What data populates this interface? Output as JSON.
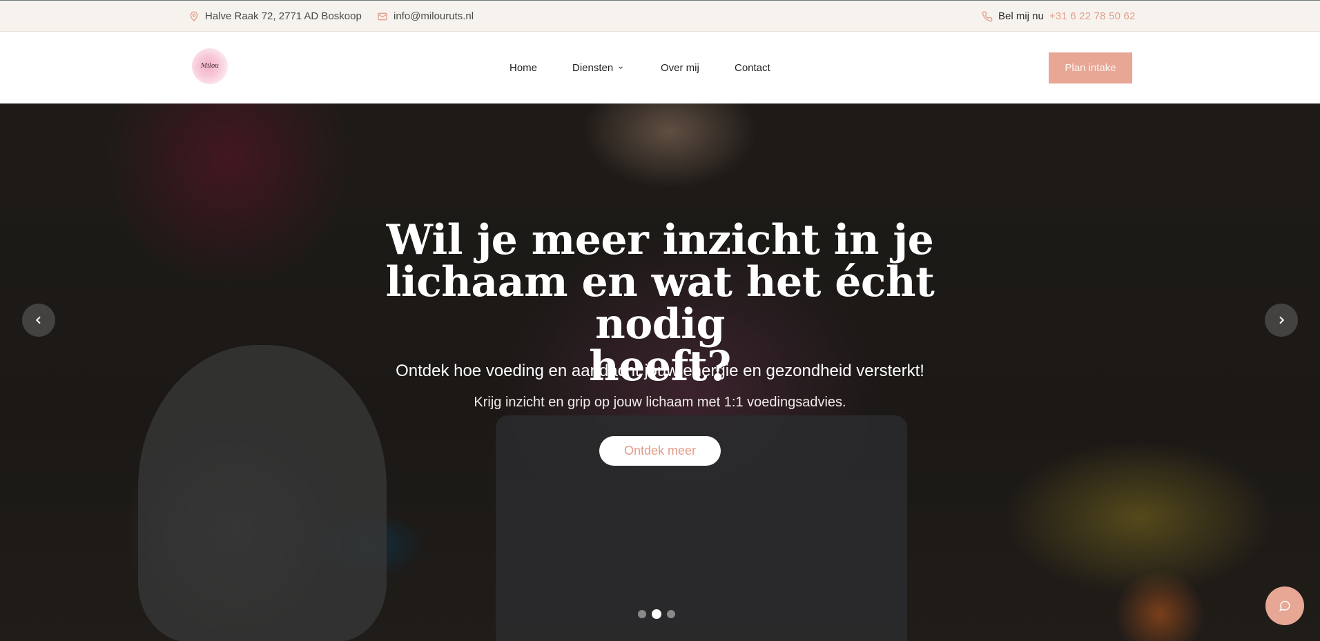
{
  "topbar": {
    "address": "Halve Raak 72, 2771 AD Boskoop",
    "email": "info@milouruts.nl",
    "call_label": "Bel mij nu",
    "phone": "+31 6 22 78 50 62"
  },
  "header": {
    "logo_text": "Milou",
    "nav": {
      "home": "Home",
      "diensten": "Diensten",
      "over_mij": "Over mij",
      "contact": "Contact"
    },
    "cta": "Plan intake"
  },
  "hero": {
    "title_line1": "Wil je meer inzicht in je",
    "title_line2": "lichaam en wat het écht nodig",
    "title_line3": "heeft?",
    "subtitle": "Ontdek hoe voeding en aandacht jouw energie en gezondheid versterkt!",
    "text": "Krijg inzicht en grip op jouw lichaam met 1:1 voedingsadvies.",
    "button": "Ontdek meer",
    "slides_total": 3,
    "active_slide": 2
  },
  "colors": {
    "accent": "#e8a695",
    "accent_text": "#e39c8a",
    "topbar_bg": "#f6f3ee"
  },
  "icons": [
    "map-pin-icon",
    "mail-icon",
    "phone-icon",
    "chevron-down-icon",
    "chevron-left-icon",
    "chevron-right-icon",
    "chat-icon"
  ]
}
